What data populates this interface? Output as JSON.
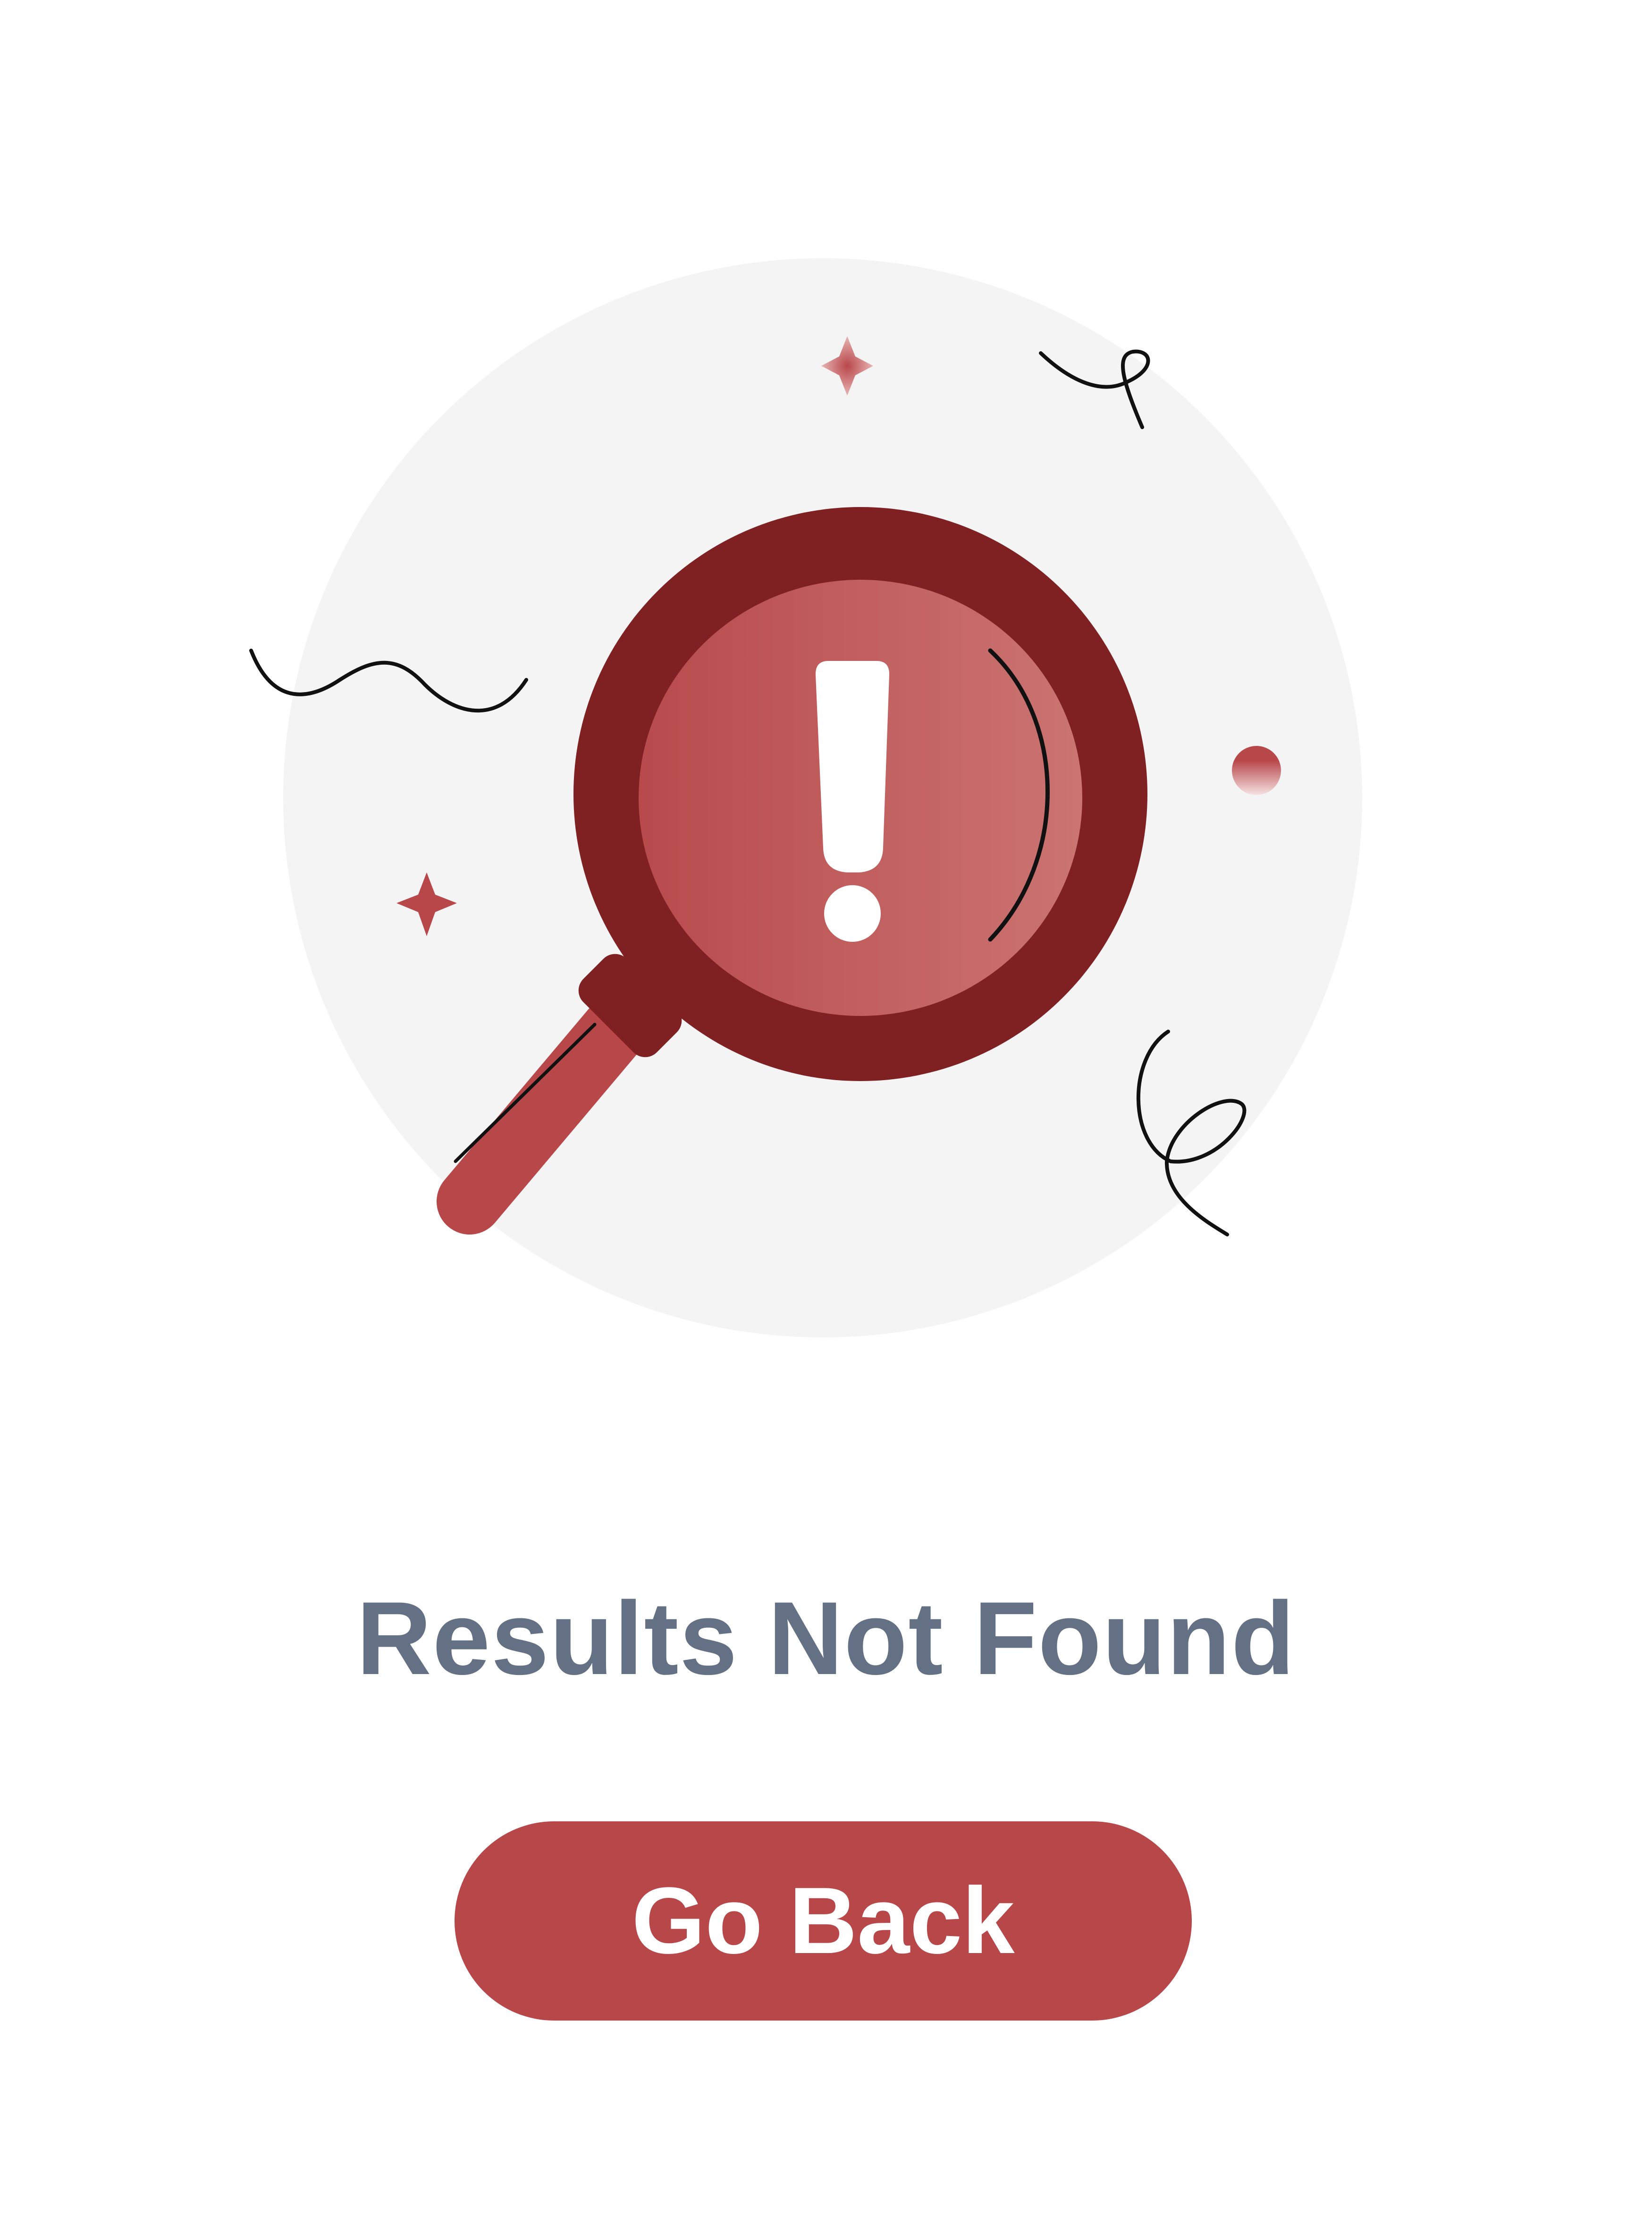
{
  "empty_state": {
    "title": "Results Not Found",
    "go_back_label": "Go Back"
  },
  "colors": {
    "accent": "#B8474A",
    "accent_dark": "#7F2023",
    "title_text": "#647184",
    "circle_bg": "#F4F4F4"
  },
  "icons": [
    "magnifier-icon",
    "exclamation-icon",
    "sparkle-icon",
    "dot-icon",
    "squiggle-icon"
  ]
}
